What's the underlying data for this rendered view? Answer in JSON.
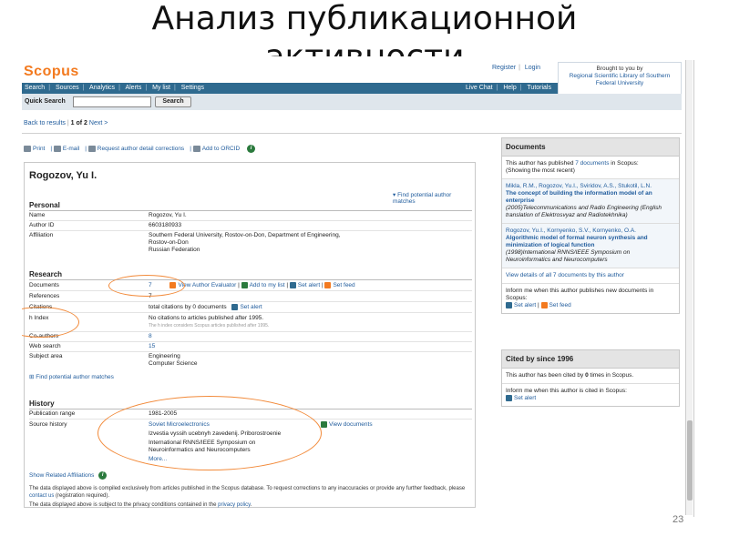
{
  "slide": {
    "title_line1": "Анализ публикационной",
    "title_line2": "активности",
    "page_number": "23"
  },
  "brand": {
    "logo": "Scopus",
    "register": "Register",
    "login": "Login",
    "brought_line1": "Brought to you by",
    "brought_org": "Regional Scientific Library of Southern Federal University"
  },
  "nav": {
    "left": [
      "Search",
      "Sources",
      "Analytics",
      "Alerts",
      "My list",
      "Settings"
    ],
    "right": [
      "Live Chat",
      "Help",
      "Tutorials"
    ]
  },
  "quick_search": {
    "label": "Quick Search",
    "value": "",
    "button": "Search"
  },
  "results_nav": {
    "back": "Back to results",
    "pos": "1 of 2",
    "next": "Next >"
  },
  "actions": [
    "Print",
    "E-mail",
    "Request author detail corrections",
    "Add to ORCID"
  ],
  "author": {
    "name": "Rogozov, Yu I.",
    "find_matches": "Find potential author matches"
  },
  "personal": {
    "heading": "Personal",
    "name_lbl": "Name",
    "name_val": "Rogozov, Yu I.",
    "id_lbl": "Author ID",
    "id_val": "6603180933",
    "aff_lbl": "Affiliation",
    "aff_l1": "Southern Federal University, Rostov-on-Don, Department of Engineering,",
    "aff_l2": "Rostov-on-Don",
    "aff_l3": "Russian Federation"
  },
  "research": {
    "heading": "Research",
    "docs_lbl": "Documents",
    "docs_val": "7",
    "view_eval": "View Author Evaluator",
    "add_list": "Add to my list",
    "set_alert": "Set alert",
    "set_feed": "Set feed",
    "refs_lbl": "References",
    "refs_val": "7",
    "cit_lbl": "Citations",
    "cit_val": "total citations by 0 documents",
    "cit_alert": "Set alert",
    "h_lbl": "h Index",
    "h_val": "No citations to articles published after 1995.",
    "h_note": "The h index considers Scopus articles published after 1995.",
    "co_lbl": "Co-authors",
    "co_val": "8",
    "web_lbl": "Web search",
    "web_val": "15",
    "subj_lbl": "Subject area",
    "subj_1": "Engineering",
    "subj_2": "Computer Science",
    "find_matches": "Find potential author matches"
  },
  "history": {
    "heading": "History",
    "pub_lbl": "Publication range",
    "pub_val": "1981-2005",
    "src_lbl": "Source history",
    "src_1": "Soviet Microelectronics",
    "view_docs": "View documents",
    "src_2": "Izvestia vyssih ucebnyh zavedenij. Priborostroenie",
    "src_3a": "International RNNS/IEEE Symposium on",
    "src_3b": "Neuroinformatics and Neurocomputers",
    "more": "More..."
  },
  "related": "Show Related Affiliations",
  "footer": {
    "line1": "The data displayed above is compiled exclusively from articles published in the Scopus database. To request corrections to any inaccuracies or provide any further feedback,",
    "line2a": "please ",
    "contact": "contact us",
    "line2b": " (registration required).",
    "line3a": "The data displayed above is subject to the privacy conditions contained in the ",
    "privacy": "privacy policy",
    "line3b": "."
  },
  "documents_panel": {
    "heading": "Documents",
    "intro_a": "This author has published ",
    "intro_link": "7 documents",
    "intro_b": " in Scopus:",
    "intro_c": "(Showing the most recent)",
    "d1_authors": "Mikla, R.M., Rogozov, Yu.I., Sviridov, A.S., Stukotil, L.N.",
    "d1_title": "The concept of building the information model of an enterprise",
    "d1_src": "(2005)Telecommunications and Radio Engineering (English translation of Elektrosvyaz and Radiotekhnika)",
    "d2_authors": "Rogozov, Yu.I., Kornyenko, S.V., Kornyenko, O.A.",
    "d2_title": "Algorithmic model of formal neuron synthesis and minimization of logical function",
    "d2_src": "(1998)International RNNS/IEEE Symposium on Neuroinformatics and Neurocomputers",
    "view_all": "View details of all 7 documents by this author",
    "inform": "Inform me when this author publishes new documents in Scopus:",
    "set_alert": "Set alert",
    "set_feed": "Set feed"
  },
  "cited_panel": {
    "heading": "Cited by since 1996",
    "text_a": "This author has been cited by ",
    "text_b": "0",
    "text_c": " times in Scopus.",
    "inform": "Inform me when this author is cited in Scopus:",
    "set_alert": "Set alert"
  }
}
